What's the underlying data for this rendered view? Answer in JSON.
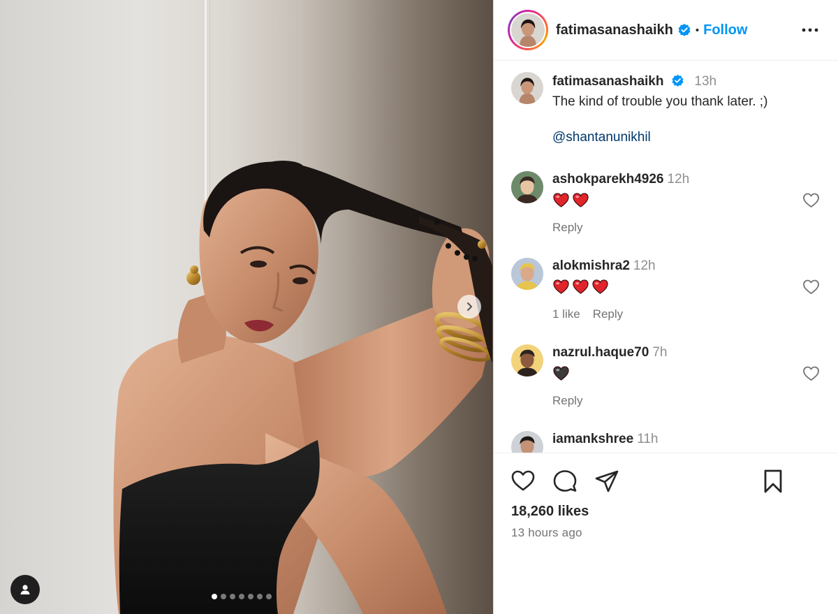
{
  "post": {
    "username": "fatimasanashaikh",
    "follow_label": "Follow",
    "separator": "•",
    "caption_time": "13h",
    "caption_text": "The kind of trouble you thank later. ;)",
    "mention": "@shantanunikhil",
    "carousel": {
      "slide_count": 7,
      "active_slide": 1
    }
  },
  "comments": [
    {
      "username": "ashokparekh4926",
      "time": "12h",
      "hearts": 2,
      "heart_color": "#e0252b",
      "likes": "",
      "reply": "Reply"
    },
    {
      "username": "alokmishra2",
      "time": "12h",
      "hearts": 3,
      "heart_color": "#e0252b",
      "likes": "1 like",
      "reply": "Reply"
    },
    {
      "username": "nazrul.haque70",
      "time": "7h",
      "hearts": 1,
      "heart_color": "#3a3a3a",
      "likes": "",
      "reply": "Reply"
    },
    {
      "username": "iamankshree",
      "time": "11h",
      "hearts": 0,
      "heart_color": "",
      "likes": "",
      "reply": ""
    }
  ],
  "footer": {
    "likes": "18,260 likes",
    "posted": "13 hours ago"
  },
  "colors": {
    "accent": "#0095f6",
    "mention": "#00376b",
    "verified": "#0095f6",
    "muted": "#737373"
  },
  "icons": {
    "more": "more-horizontal-icon",
    "like": "heart-outline-icon",
    "comment": "comment-bubble-icon",
    "share": "paper-plane-icon",
    "save": "bookmark-icon",
    "next": "chevron-right-icon",
    "tags": "user-tag-icon",
    "verified": "verified-badge-icon"
  }
}
